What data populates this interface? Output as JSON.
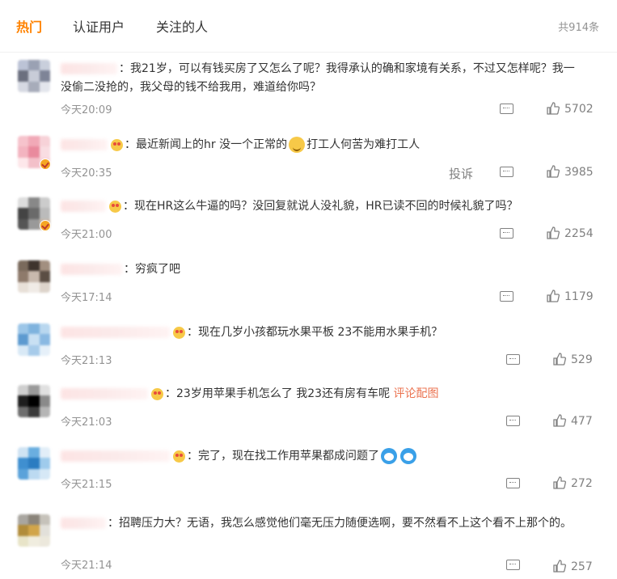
{
  "tabs": [
    "热门",
    "认证用户",
    "关注的人"
  ],
  "total": "共914条",
  "report_label": "投诉",
  "colors": {
    "accent": "#ff8200",
    "link": "#eb7350",
    "muted": "#939393"
  },
  "comments": [
    {
      "text": "我21岁，可以有钱买房了又怎么了呢？我得承认的确和家境有关系，不过又怎样呢？我一",
      "text2": "没偷二没抢的，我父母的钱不给我用，难道给你吗？",
      "time": "今天20:09",
      "likes": "5702",
      "icon": "comment-icon"
    },
    {
      "text": "最近新闻上的hr 没一个正常的",
      "text_after": "打工人何苦为难打工人",
      "time": "今天20:35",
      "likes": "3985",
      "icon": "comment-icon"
    },
    {
      "text": "现在HR这么牛逼的吗？没回复就说人没礼貌，HR已读不回的时候礼貌了吗？",
      "time": "今天21:00",
      "likes": "2254",
      "icon": "comment-icon"
    },
    {
      "text": "穷疯了吧",
      "time": "今天17:14",
      "likes": "1179",
      "icon": "comment-icon"
    },
    {
      "text": "现在几岁小孩都玩水果平板 23不能用水果手机？",
      "time": "今天21:13",
      "likes": "529",
      "icon": "comment-icon"
    },
    {
      "text": "23岁用苹果手机怎么了 我23还有房有车呢",
      "link": "评论配图",
      "time": "今天21:03",
      "likes": "477",
      "icon": "comment-icon"
    },
    {
      "text": "完了，现在找工作用苹果都成问题了",
      "time": "今天21:15",
      "likes": "272",
      "icon": "comment-icon"
    },
    {
      "text": "招聘压力大？无语，我怎么感觉他们毫无压力随便选啊，要不然看不上这个看不上那个的。",
      "time": "今天21:14",
      "likes": "257",
      "icon": "comment-icon"
    }
  ]
}
